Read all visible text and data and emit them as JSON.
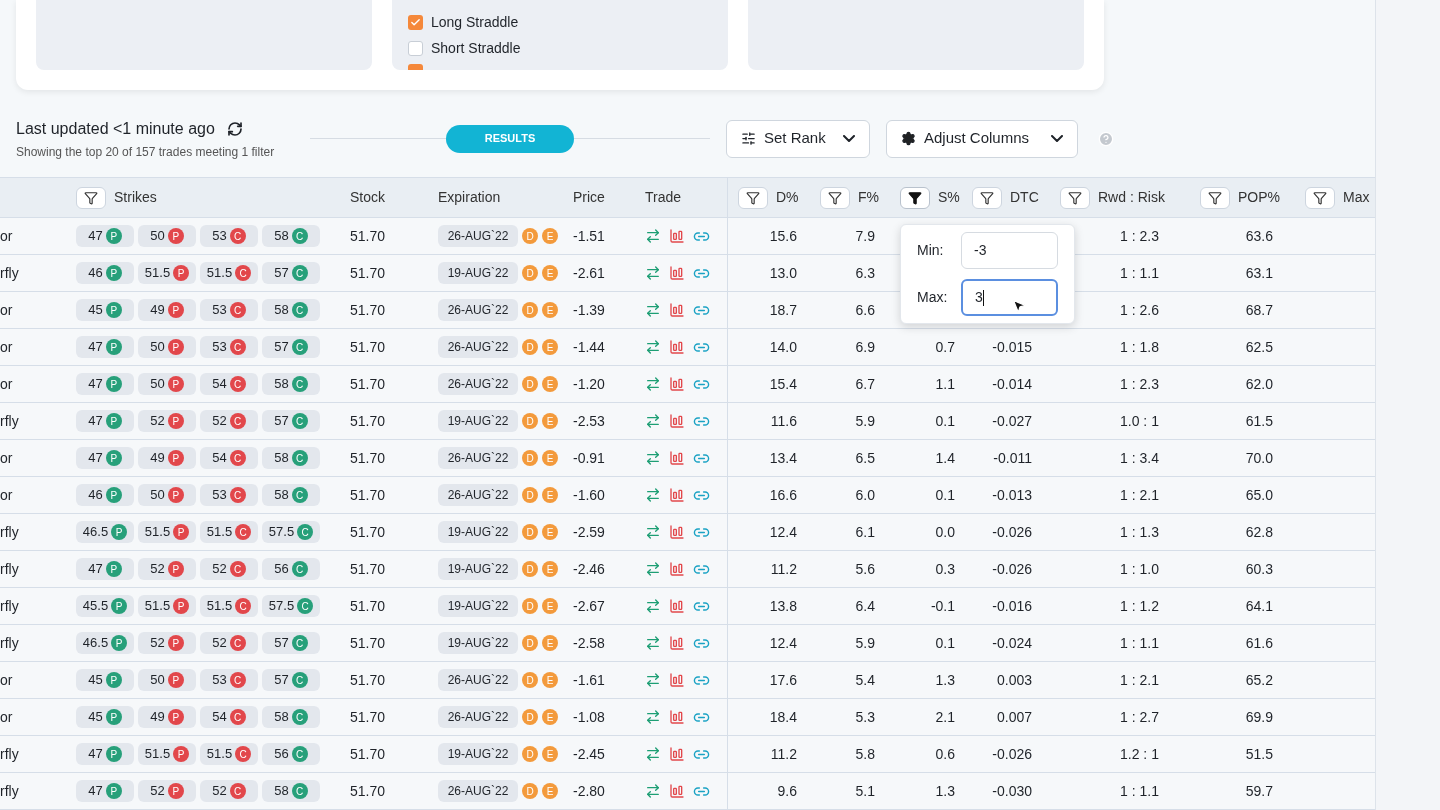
{
  "strategy_panel": {
    "items": [
      {
        "label": "Long Straddle",
        "checked": true
      },
      {
        "label": "Short Straddle",
        "checked": false
      }
    ],
    "cut_off_item": {
      "checked": true
    }
  },
  "results_bar": {
    "title": "Last updated <1 minute ago",
    "subtitle": "Showing the top 20 of 157 trades meeting 1 filter",
    "pill": "RESULTS",
    "buttons": [
      {
        "label": "Set Rank",
        "kind": "rank"
      },
      {
        "label": "Adjust Columns",
        "kind": "columns"
      }
    ]
  },
  "table": {
    "columns": [
      {
        "label": "Strikes",
        "kind": "filter",
        "filter_active": false
      },
      {
        "label": "Stock",
        "kind": "plain"
      },
      {
        "label": "Expiration",
        "kind": "plain"
      },
      {
        "label": "Price",
        "kind": "plain"
      },
      {
        "label": "Trade",
        "kind": "plain"
      },
      {
        "label": "D%",
        "kind": "filter",
        "filter_active": false
      },
      {
        "label": "F%",
        "kind": "filter",
        "filter_active": false
      },
      {
        "label": "S%",
        "kind": "filter",
        "filter_active": true
      },
      {
        "label": "DTC",
        "kind": "filter",
        "filter_active": false
      },
      {
        "label": "Rwd : Risk",
        "kind": "filter",
        "filter_active": false
      },
      {
        "label": "POP%",
        "kind": "filter",
        "filter_active": false
      },
      {
        "label": "Max",
        "kind": "filter",
        "filter_active": false
      }
    ],
    "rows": [
      {
        "name": "or",
        "strikes": [
          {
            "strike": "47",
            "letter": "P",
            "color": "#27a07a"
          },
          {
            "strike": "50",
            "letter": "P",
            "color": "#e2474b"
          },
          {
            "strike": "53",
            "letter": "C",
            "color": "#e2474b"
          },
          {
            "strike": "58",
            "letter": "C",
            "color": "#27a07a"
          }
        ],
        "stock": "51.70",
        "expiration": "26-AUG`22",
        "badges": [
          "D",
          "E"
        ],
        "price": "-1.51",
        "d": "15.6",
        "f": "7.9",
        "rwd_risk": "1 : 2.3",
        "pop": "63.6"
      },
      {
        "name": "rfly",
        "strikes": [
          {
            "strike": "46",
            "letter": "P",
            "color": "#27a07a"
          },
          {
            "strike": "51.5",
            "letter": "P",
            "color": "#e2474b"
          },
          {
            "strike": "51.5",
            "letter": "C",
            "color": "#e2474b"
          },
          {
            "strike": "57",
            "letter": "C",
            "color": "#27a07a"
          }
        ],
        "stock": "51.70",
        "expiration": "19-AUG`22",
        "badges": [
          "D",
          "E"
        ],
        "price": "-2.61",
        "d": "13.0",
        "f": "6.3",
        "rwd_risk": "1 : 1.1",
        "pop": "63.1"
      },
      {
        "name": "or",
        "strikes": [
          {
            "strike": "45",
            "letter": "P",
            "color": "#27a07a"
          },
          {
            "strike": "49",
            "letter": "P",
            "color": "#e2474b"
          },
          {
            "strike": "53",
            "letter": "C",
            "color": "#e2474b"
          },
          {
            "strike": "58",
            "letter": "C",
            "color": "#27a07a"
          }
        ],
        "stock": "51.70",
        "expiration": "26-AUG`22",
        "badges": [
          "D",
          "E"
        ],
        "price": "-1.39",
        "d": "18.7",
        "f": "6.6",
        "rwd_risk": "1 : 2.6",
        "pop": "68.7"
      },
      {
        "name": "or",
        "strikes": [
          {
            "strike": "47",
            "letter": "P",
            "color": "#27a07a"
          },
          {
            "strike": "50",
            "letter": "P",
            "color": "#e2474b"
          },
          {
            "strike": "53",
            "letter": "C",
            "color": "#e2474b"
          },
          {
            "strike": "57",
            "letter": "C",
            "color": "#27a07a"
          }
        ],
        "stock": "51.70",
        "expiration": "26-AUG`22",
        "badges": [
          "D",
          "E"
        ],
        "price": "-1.44",
        "d": "14.0",
        "f": "6.9",
        "s": "0.7",
        "dtc": "-0.015",
        "rwd_risk": "1 : 1.8",
        "pop": "62.5"
      },
      {
        "name": "or",
        "strikes": [
          {
            "strike": "47",
            "letter": "P",
            "color": "#27a07a"
          },
          {
            "strike": "50",
            "letter": "P",
            "color": "#e2474b"
          },
          {
            "strike": "54",
            "letter": "C",
            "color": "#e2474b"
          },
          {
            "strike": "58",
            "letter": "C",
            "color": "#27a07a"
          }
        ],
        "stock": "51.70",
        "expiration": "26-AUG`22",
        "badges": [
          "D",
          "E"
        ],
        "price": "-1.20",
        "d": "15.4",
        "f": "6.7",
        "s": "1.1",
        "dtc": "-0.014",
        "rwd_risk": "1 : 2.3",
        "pop": "62.0"
      },
      {
        "name": "rfly",
        "strikes": [
          {
            "strike": "47",
            "letter": "P",
            "color": "#27a07a"
          },
          {
            "strike": "52",
            "letter": "P",
            "color": "#e2474b"
          },
          {
            "strike": "52",
            "letter": "C",
            "color": "#e2474b"
          },
          {
            "strike": "57",
            "letter": "C",
            "color": "#27a07a"
          }
        ],
        "stock": "51.70",
        "expiration": "19-AUG`22",
        "badges": [
          "D",
          "E"
        ],
        "price": "-2.53",
        "d": "11.6",
        "f": "5.9",
        "s": "0.1",
        "dtc": "-0.027",
        "rwd_risk": "1.0 : 1",
        "pop": "61.5"
      },
      {
        "name": "or",
        "strikes": [
          {
            "strike": "47",
            "letter": "P",
            "color": "#27a07a"
          },
          {
            "strike": "49",
            "letter": "P",
            "color": "#e2474b"
          },
          {
            "strike": "54",
            "letter": "C",
            "color": "#e2474b"
          },
          {
            "strike": "58",
            "letter": "C",
            "color": "#27a07a"
          }
        ],
        "stock": "51.70",
        "expiration": "26-AUG`22",
        "badges": [
          "D",
          "E"
        ],
        "price": "-0.91",
        "d": "13.4",
        "f": "6.5",
        "s": "1.4",
        "dtc": "-0.011",
        "rwd_risk": "1 : 3.4",
        "pop": "70.0"
      },
      {
        "name": "or",
        "strikes": [
          {
            "strike": "46",
            "letter": "P",
            "color": "#27a07a"
          },
          {
            "strike": "50",
            "letter": "P",
            "color": "#e2474b"
          },
          {
            "strike": "53",
            "letter": "C",
            "color": "#e2474b"
          },
          {
            "strike": "58",
            "letter": "C",
            "color": "#27a07a"
          }
        ],
        "stock": "51.70",
        "expiration": "26-AUG`22",
        "badges": [
          "D",
          "E"
        ],
        "price": "-1.60",
        "d": "16.6",
        "f": "6.0",
        "s": "0.1",
        "dtc": "-0.013",
        "rwd_risk": "1 : 2.1",
        "pop": "65.0"
      },
      {
        "name": "rfly",
        "strikes": [
          {
            "strike": "46.5",
            "letter": "P",
            "color": "#27a07a"
          },
          {
            "strike": "51.5",
            "letter": "P",
            "color": "#e2474b"
          },
          {
            "strike": "51.5",
            "letter": "C",
            "color": "#e2474b"
          },
          {
            "strike": "57.5",
            "letter": "C",
            "color": "#27a07a"
          }
        ],
        "stock": "51.70",
        "expiration": "19-AUG`22",
        "badges": [
          "D",
          "E"
        ],
        "price": "-2.59",
        "d": "12.4",
        "f": "6.1",
        "s": "0.0",
        "dtc": "-0.026",
        "rwd_risk": "1 : 1.3",
        "pop": "62.8"
      },
      {
        "name": "rfly",
        "strikes": [
          {
            "strike": "47",
            "letter": "P",
            "color": "#27a07a"
          },
          {
            "strike": "52",
            "letter": "P",
            "color": "#e2474b"
          },
          {
            "strike": "52",
            "letter": "C",
            "color": "#e2474b"
          },
          {
            "strike": "56",
            "letter": "C",
            "color": "#27a07a"
          }
        ],
        "stock": "51.70",
        "expiration": "19-AUG`22",
        "badges": [
          "D",
          "E"
        ],
        "price": "-2.46",
        "d": "11.2",
        "f": "5.6",
        "s": "0.3",
        "dtc": "-0.026",
        "rwd_risk": "1 : 1.0",
        "pop": "60.3"
      },
      {
        "name": "rfly",
        "strikes": [
          {
            "strike": "45.5",
            "letter": "P",
            "color": "#27a07a"
          },
          {
            "strike": "51.5",
            "letter": "P",
            "color": "#e2474b"
          },
          {
            "strike": "51.5",
            "letter": "C",
            "color": "#e2474b"
          },
          {
            "strike": "57.5",
            "letter": "C",
            "color": "#27a07a"
          }
        ],
        "stock": "51.70",
        "expiration": "19-AUG`22",
        "badges": [
          "D",
          "E"
        ],
        "price": "-2.67",
        "d": "13.8",
        "f": "6.4",
        "s": "-0.1",
        "dtc": "-0.016",
        "rwd_risk": "1 : 1.2",
        "pop": "64.1"
      },
      {
        "name": "rfly",
        "strikes": [
          {
            "strike": "46.5",
            "letter": "P",
            "color": "#27a07a"
          },
          {
            "strike": "52",
            "letter": "P",
            "color": "#e2474b"
          },
          {
            "strike": "52",
            "letter": "C",
            "color": "#e2474b"
          },
          {
            "strike": "57",
            "letter": "C",
            "color": "#27a07a"
          }
        ],
        "stock": "51.70",
        "expiration": "19-AUG`22",
        "badges": [
          "D",
          "E"
        ],
        "price": "-2.58",
        "d": "12.4",
        "f": "5.9",
        "s": "0.1",
        "dtc": "-0.024",
        "rwd_risk": "1 : 1.1",
        "pop": "61.6"
      },
      {
        "name": "or",
        "strikes": [
          {
            "strike": "45",
            "letter": "P",
            "color": "#27a07a"
          },
          {
            "strike": "50",
            "letter": "P",
            "color": "#e2474b"
          },
          {
            "strike": "53",
            "letter": "C",
            "color": "#e2474b"
          },
          {
            "strike": "57",
            "letter": "C",
            "color": "#27a07a"
          }
        ],
        "stock": "51.70",
        "expiration": "26-AUG`22",
        "badges": [
          "D",
          "E"
        ],
        "price": "-1.61",
        "d": "17.6",
        "f": "5.4",
        "s": "1.3",
        "dtc": "0.003",
        "rwd_risk": "1 : 2.1",
        "pop": "65.2"
      },
      {
        "name": "or",
        "strikes": [
          {
            "strike": "45",
            "letter": "P",
            "color": "#27a07a"
          },
          {
            "strike": "49",
            "letter": "P",
            "color": "#e2474b"
          },
          {
            "strike": "54",
            "letter": "C",
            "color": "#e2474b"
          },
          {
            "strike": "58",
            "letter": "C",
            "color": "#27a07a"
          }
        ],
        "stock": "51.70",
        "expiration": "26-AUG`22",
        "badges": [
          "D",
          "E"
        ],
        "price": "-1.08",
        "d": "18.4",
        "f": "5.3",
        "s": "2.1",
        "dtc": "0.007",
        "rwd_risk": "1 : 2.7",
        "pop": "69.9"
      },
      {
        "name": "rfly",
        "strikes": [
          {
            "strike": "47",
            "letter": "P",
            "color": "#27a07a"
          },
          {
            "strike": "51.5",
            "letter": "P",
            "color": "#e2474b"
          },
          {
            "strike": "51.5",
            "letter": "C",
            "color": "#e2474b"
          },
          {
            "strike": "56",
            "letter": "C",
            "color": "#27a07a"
          }
        ],
        "stock": "51.70",
        "expiration": "19-AUG`22",
        "badges": [
          "D",
          "E"
        ],
        "price": "-2.45",
        "d": "11.2",
        "f": "5.8",
        "s": "0.6",
        "dtc": "-0.026",
        "rwd_risk": "1.2 : 1",
        "pop": "51.5"
      },
      {
        "name": "rfly",
        "strikes": [
          {
            "strike": "47",
            "letter": "P",
            "color": "#27a07a"
          },
          {
            "strike": "52",
            "letter": "P",
            "color": "#e2474b"
          },
          {
            "strike": "52",
            "letter": "C",
            "color": "#e2474b"
          },
          {
            "strike": "58",
            "letter": "C",
            "color": "#27a07a"
          }
        ],
        "stock": "51.70",
        "expiration": "26-AUG`22",
        "badges": [
          "D",
          "E"
        ],
        "price": "-2.80",
        "d": "9.6",
        "f": "5.1",
        "s": "1.3",
        "dtc": "-0.030",
        "rwd_risk": "1 : 1.1",
        "pop": "59.7"
      }
    ]
  },
  "filter_popup": {
    "fields": [
      {
        "label": "Min:",
        "value": "-3",
        "focused": false
      },
      {
        "label": "Max:",
        "value": "3",
        "focused": true
      }
    ]
  }
}
